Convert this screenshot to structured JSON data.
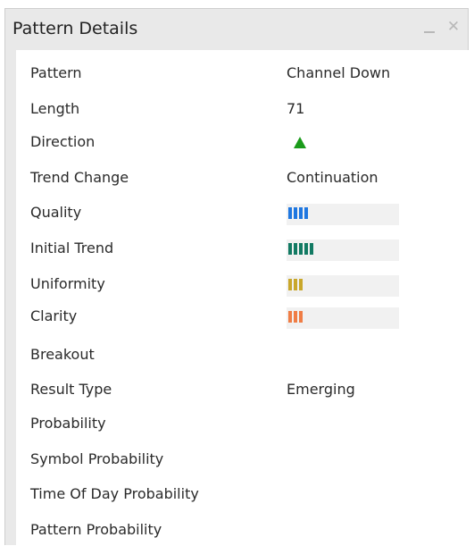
{
  "window": {
    "title": "Pattern Details",
    "minimize_icon": "minimize-icon",
    "close_icon": "close-icon",
    "close_glyph": "✕"
  },
  "details": [
    {
      "label": "Pattern",
      "value": "Channel Down"
    },
    {
      "label": "Length",
      "value": "71"
    },
    {
      "label": "Direction",
      "indicator": "up-arrow",
      "color": "#1a9b1a"
    },
    {
      "label": "Trend Change",
      "value": "Continuation"
    },
    {
      "label": "Quality",
      "meter": {
        "bars": 4,
        "color": "#1f77e0"
      }
    },
    {
      "label": "Initial Trend",
      "meter": {
        "bars": 5,
        "color": "#127a63"
      }
    },
    {
      "label": "Uniformity",
      "meter": {
        "bars": 3,
        "color": "#c9a72b"
      }
    },
    {
      "label": "Clarity",
      "meter": {
        "bars": 3,
        "color": "#f07d45"
      }
    },
    {
      "label": "Breakout",
      "value": ""
    },
    {
      "label": "Result Type",
      "value": "Emerging"
    },
    {
      "label": "Probability",
      "value": ""
    },
    {
      "label": "Symbol Probability",
      "value": ""
    },
    {
      "label": "Time Of Day Probability",
      "value": ""
    },
    {
      "label": "Pattern Probability",
      "value": ""
    }
  ]
}
